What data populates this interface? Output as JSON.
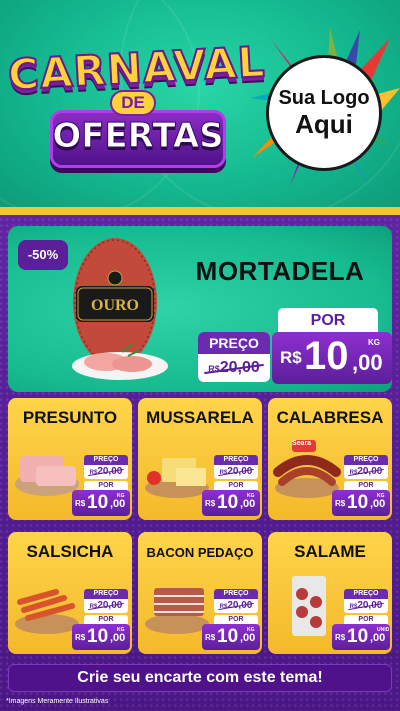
{
  "header": {
    "title_line1": "CARNAVAL",
    "title_line2": "DE",
    "title_line3": "OFERTAS",
    "logo_line1": "Sua Logo",
    "logo_line2": "Aqui"
  },
  "featured": {
    "discount_badge": "-50%",
    "name": "MORTADELA",
    "por_label": "POR",
    "preco_label": "PREÇO",
    "old_currency": "R$",
    "old_price": "20,00",
    "currency": "R$",
    "price_int": "10",
    "price_dec": ",00",
    "unit": "KG",
    "brand_label": "OURO"
  },
  "products": [
    {
      "name": "PRESUNTO",
      "preco_label": "PREÇO",
      "old_currency": "R$",
      "old_price": "20,00",
      "por_label": "POR",
      "currency": "R$",
      "price_int": "10",
      "price_dec": ",00",
      "unit": "KG"
    },
    {
      "name": "MUSSARELA",
      "preco_label": "PREÇO",
      "old_currency": "R$",
      "old_price": "20,00",
      "por_label": "POR",
      "currency": "R$",
      "price_int": "10",
      "price_dec": ",00",
      "unit": "KG"
    },
    {
      "name": "CALABRESA",
      "preco_label": "PREÇO",
      "old_currency": "R$",
      "old_price": "20,00",
      "por_label": "POR",
      "currency": "R$",
      "price_int": "10",
      "price_dec": ",00",
      "unit": "KG",
      "brand_label": "Seara"
    },
    {
      "name": "SALSICHA",
      "preco_label": "PREÇO",
      "old_currency": "R$",
      "old_price": "20,00",
      "por_label": "POR",
      "currency": "R$",
      "price_int": "10",
      "price_dec": ",00",
      "unit": "KG"
    },
    {
      "name": "BACON PEDAÇO",
      "preco_label": "PREÇO",
      "old_currency": "R$",
      "old_price": "20,00",
      "por_label": "POR",
      "currency": "R$",
      "price_int": "10",
      "price_dec": ",00",
      "unit": "KG"
    },
    {
      "name": "SALAME",
      "preco_label": "PREÇO",
      "old_currency": "R$",
      "old_price": "20,00",
      "por_label": "POR",
      "currency": "R$",
      "price_int": "10",
      "price_dec": ",00",
      "unit": "UNID"
    }
  ],
  "footer": {
    "cta": "Crie seu encarte com este tema!",
    "disclaimer": "*Imagens Meramente Ilustrativas"
  },
  "colors": {
    "purple": "#5b1f9a",
    "green": "#17b98f",
    "yellow": "#f3b92a"
  }
}
